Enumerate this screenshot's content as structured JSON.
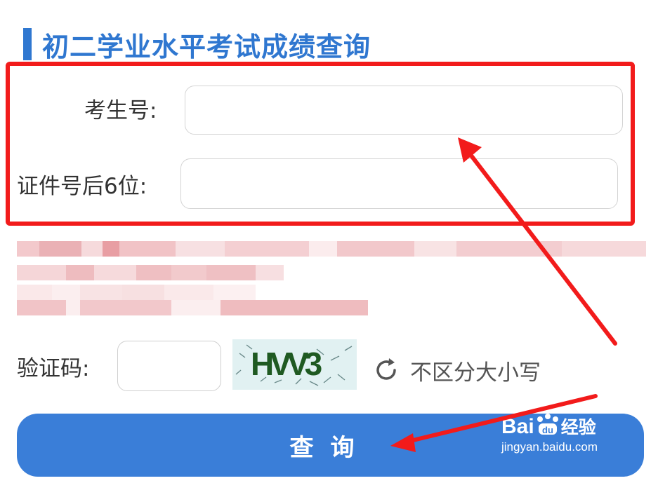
{
  "page": {
    "title": "初二学业水平考试成绩查询"
  },
  "form": {
    "student_id_label": "考生号:",
    "student_id_value": "",
    "id_last6_label": "证件号后6位:",
    "id_last6_value": ""
  },
  "captcha": {
    "label": "验证码:",
    "input_value": "",
    "image_text": "HVV3",
    "refresh_hint": "不区分大小写"
  },
  "actions": {
    "query_label": "查询"
  },
  "annotation": {
    "highlight_color": "#f21b1b"
  },
  "watermark": {
    "logo_text": "Bai",
    "logo_suffix": "经验",
    "url": "jingyan.baidu.com"
  },
  "colors": {
    "accent": "#2f77d0",
    "button": "#3a7ed8"
  }
}
